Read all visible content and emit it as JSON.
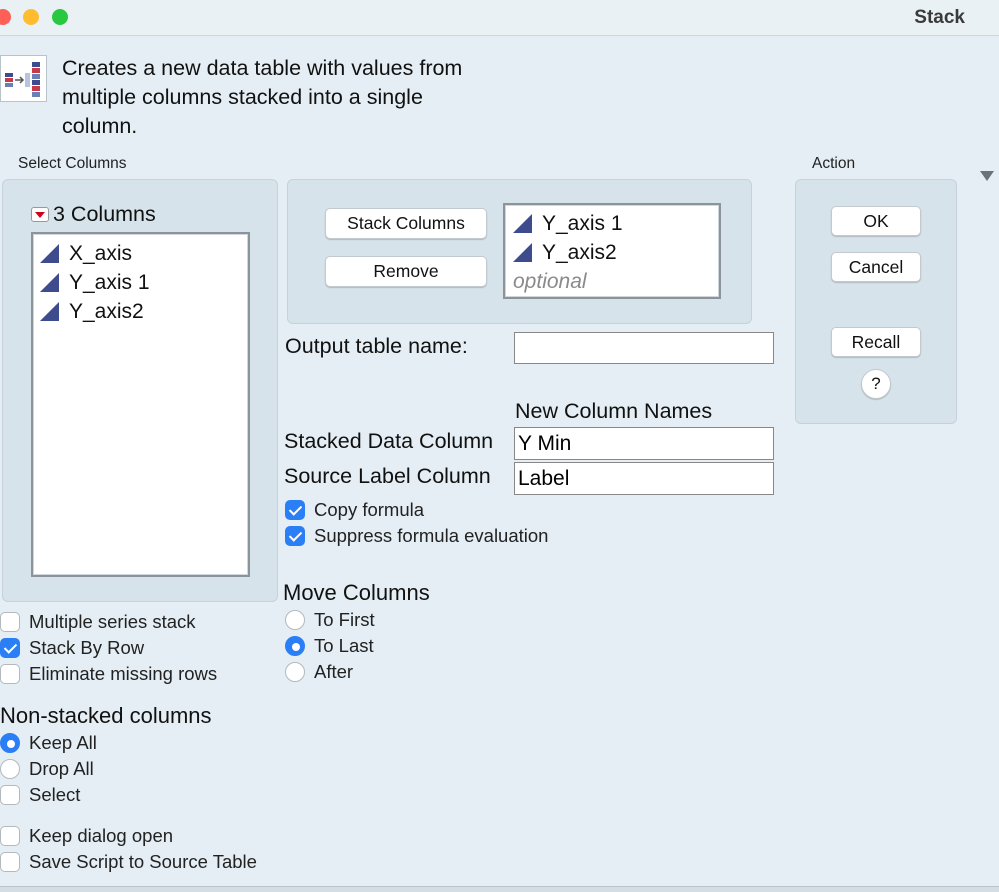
{
  "window": {
    "title": "Stack"
  },
  "description": "Creates a new data table with values from multiple columns stacked into a single column.",
  "select_columns": {
    "label": "Select Columns",
    "count_label": "3 Columns",
    "items": [
      "X_axis",
      "Y_axis 1",
      "Y_axis2"
    ]
  },
  "stack": {
    "stack_button": "Stack Columns",
    "remove_button": "Remove",
    "selected": [
      "Y_axis 1",
      "Y_axis2"
    ],
    "placeholder": "optional"
  },
  "output_table": {
    "label": "Output table name:",
    "value": ""
  },
  "new_column_names": {
    "heading": "New Column Names",
    "stacked_label": "Stacked Data Column",
    "stacked_value": "Y Min",
    "source_label": "Source Label Column",
    "source_value": "Label"
  },
  "formula_options": [
    {
      "label": "Copy formula",
      "checked": true
    },
    {
      "label": "Suppress formula evaluation",
      "checked": true
    }
  ],
  "move_columns": {
    "heading": "Move Columns",
    "options": [
      "To First",
      "To Last",
      "After"
    ],
    "selected": "To Last"
  },
  "stack_options": [
    {
      "label": "Multiple series stack",
      "checked": false
    },
    {
      "label": "Stack By Row",
      "checked": true
    },
    {
      "label": "Eliminate missing rows",
      "checked": false
    }
  ],
  "non_stacked": {
    "heading": "Non-stacked columns",
    "options": [
      "Keep All",
      "Drop All"
    ],
    "selected": "Keep All",
    "select_label": "Select"
  },
  "dialog_options": [
    {
      "label": "Keep dialog open",
      "checked": false
    },
    {
      "label": "Save Script to Source Table",
      "checked": false
    }
  ],
  "action": {
    "label": "Action",
    "ok": "OK",
    "cancel": "Cancel",
    "recall": "Recall",
    "help": "?"
  },
  "colors": {
    "accent": "#2b7ff6",
    "background": "#e4eef4",
    "panel": "#d7e3ea",
    "column_icon": "#3e4c8e",
    "traffic_red": "#fe5f57",
    "traffic_yellow": "#febc2e",
    "traffic_green": "#28c840"
  }
}
